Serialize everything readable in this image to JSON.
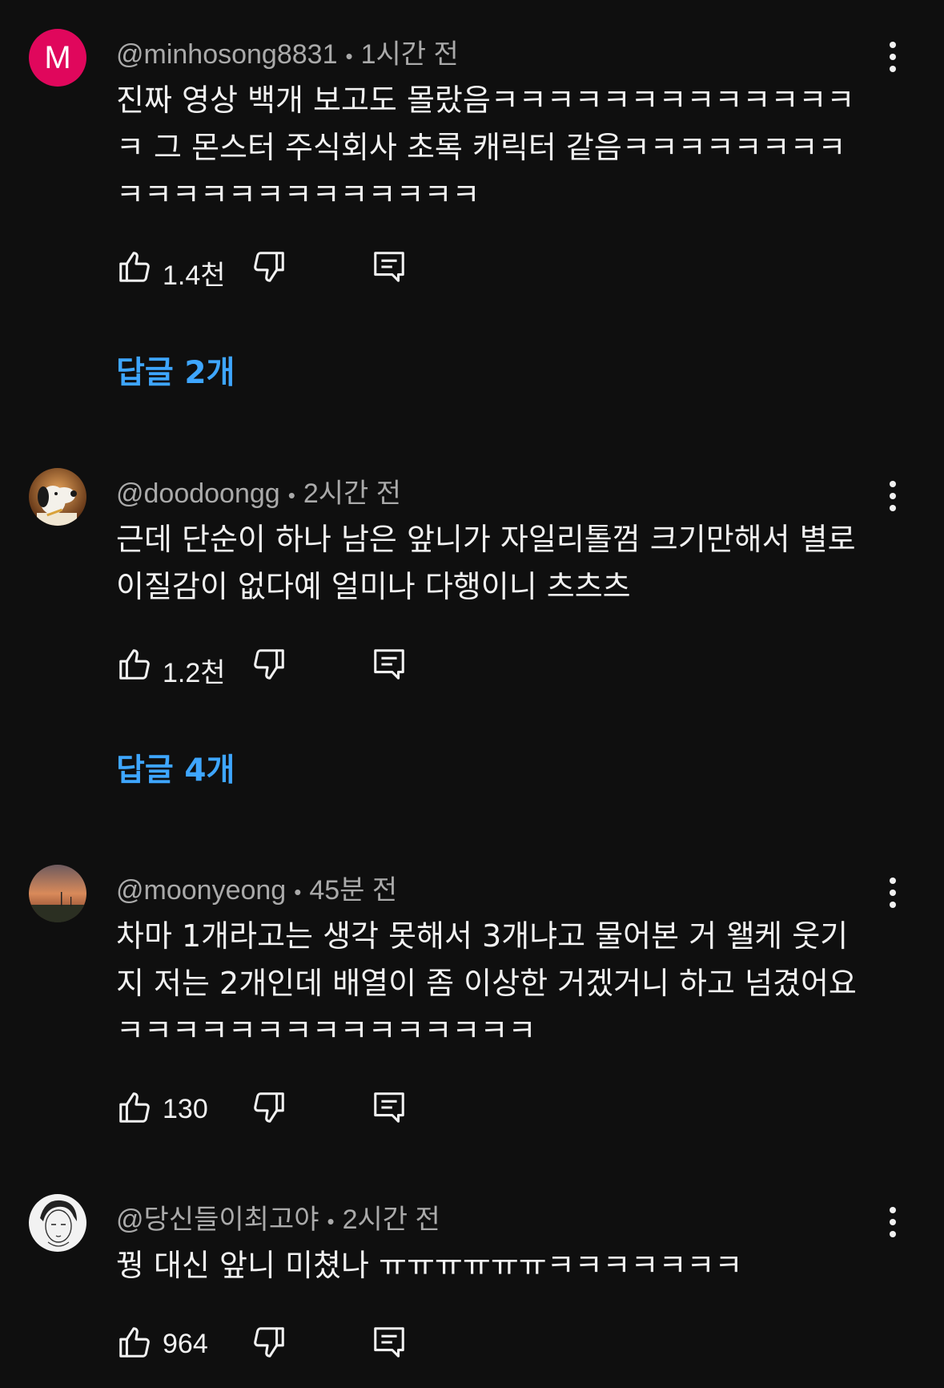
{
  "comments": [
    {
      "avatar_letter": "M",
      "avatar_color": "#e0075c",
      "author": "@minhosong8831",
      "time": "1시간 전",
      "text": "진짜 영상 백개 보고도 몰랐음ㅋㅋㅋㅋㅋㅋㅋㅋㅋㅋㅋㅋㅋㅋ 그 몬스터 주식회사 초록 캐릭터 같음ㅋㅋㅋㅋㅋㅋㅋㅋㅋㅋㅋㅋㅋㅋㅋㅋㅋㅋㅋㅋㅋ",
      "likes": "1.4천",
      "replies_label": "답글 2개"
    },
    {
      "author": "@doodoongg",
      "time": "2시간 전",
      "text": "근데 단순이 하나 남은 앞니가 자일리톨껌 크기만해서 별로 이질감이 없다예 얼미나 다행이니 츠츠츠",
      "likes": "1.2천",
      "replies_label": "답글 4개"
    },
    {
      "author": "@moonyeong",
      "time": "45분 전",
      "text": "차마 1개라고는 생각 못해서 3개냐고 물어본 거 왤케 웃기지 저는 2개인데 배열이 좀 이상한 거겠거니 하고 넘겼어요 ㅋㅋㅋㅋㅋㅋㅋㅋㅋㅋㅋㅋㅋㅋㅋ",
      "likes": "130"
    },
    {
      "author": "@당신들이최고야",
      "time": "2시간 전",
      "text": "꿩 대신 앞니 미쳤나 ㅠㅠㅠㅠㅠㅠㅋㅋㅋㅋㅋㅋㅋ",
      "likes": "964"
    }
  ],
  "colors": {
    "background": "#0f0f0f",
    "text": "#f1f1f1",
    "meta": "#aaaaaa",
    "link": "#3ea6ff"
  }
}
